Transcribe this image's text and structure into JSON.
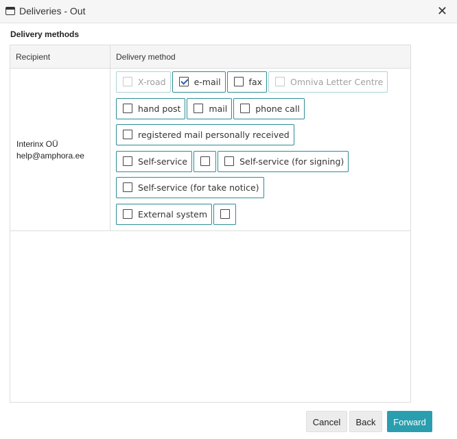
{
  "window": {
    "title": "Deliveries - Out"
  },
  "section": {
    "title": "Delivery methods"
  },
  "table": {
    "headers": [
      "Recipient",
      "Delivery method"
    ],
    "rows": [
      {
        "recipient_name": "Interinx OÜ",
        "recipient_email": "help@amphora.ee",
        "options": [
          [
            {
              "label": "X-road",
              "checked": false,
              "disabled": true
            },
            {
              "label": "e-mail",
              "checked": true,
              "disabled": false
            },
            {
              "label": "fax",
              "checked": false,
              "disabled": false
            },
            {
              "label": "Omniva Letter Centre",
              "checked": false,
              "disabled": true
            }
          ],
          [
            {
              "label": "hand post",
              "checked": false,
              "disabled": false
            },
            {
              "label": "mail",
              "checked": false,
              "disabled": false
            },
            {
              "label": "phone call",
              "checked": false,
              "disabled": false
            }
          ],
          [
            {
              "label": "registered mail personally received",
              "checked": false,
              "disabled": false
            }
          ],
          [
            {
              "label": "Self-service",
              "checked": false,
              "disabled": false
            },
            {
              "label": "",
              "checked": false,
              "disabled": false
            },
            {
              "label": "Self-service (for signing)",
              "checked": false,
              "disabled": false
            }
          ],
          [
            {
              "label": "Self-service (for take notice)",
              "checked": false,
              "disabled": false
            }
          ],
          [
            {
              "label": "External system",
              "checked": false,
              "disabled": false
            },
            {
              "label": "",
              "checked": false,
              "disabled": false
            }
          ]
        ]
      }
    ]
  },
  "buttons": {
    "cancel": "Cancel",
    "back": "Back",
    "forward": "Forward"
  },
  "colors": {
    "accent": "#2a9eae",
    "chip_border": "#2b8c96",
    "check": "#2f5fa8"
  }
}
